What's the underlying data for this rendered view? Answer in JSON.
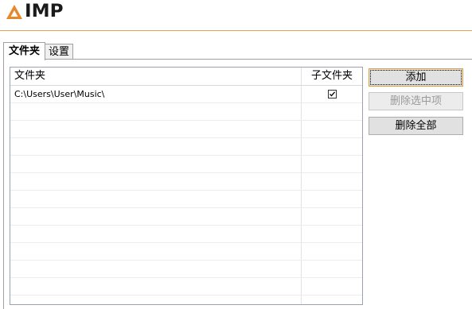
{
  "app": {
    "logo_text": "IMP",
    "accent_color": "#e8872a"
  },
  "tabs": [
    {
      "label": "文件夹",
      "active": true
    },
    {
      "label": "设置",
      "active": false
    }
  ],
  "list": {
    "columns": {
      "folder": "文件夹",
      "subfolders": "子文件夹"
    },
    "rows": [
      {
        "folder": "C:\\Users\\User\\Music\\",
        "subfolders": true
      }
    ]
  },
  "buttons": {
    "add": "添加",
    "delete_selected": "删除选中项",
    "delete_all": "删除全部"
  }
}
